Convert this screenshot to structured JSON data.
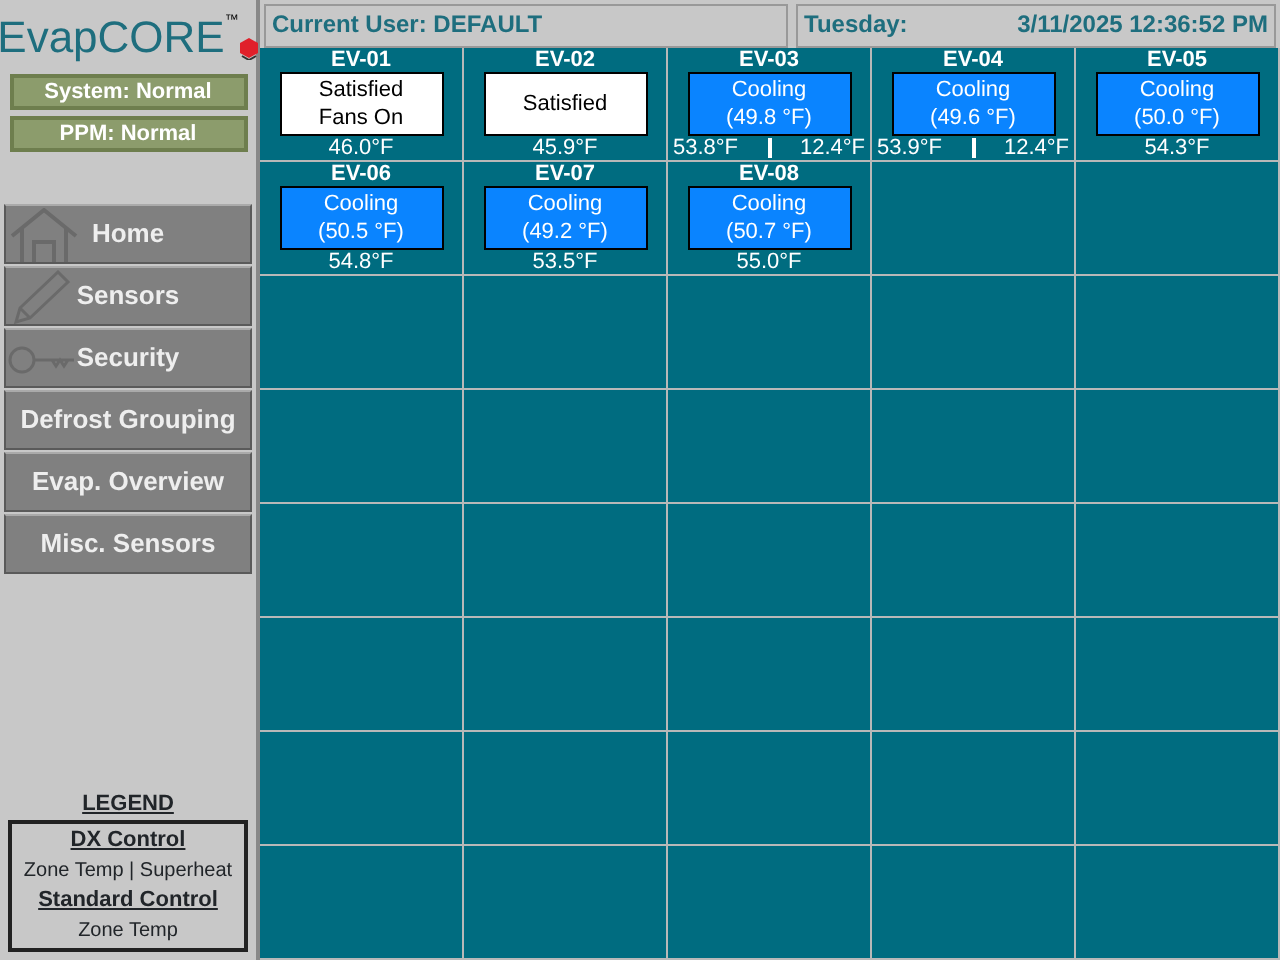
{
  "logo": {
    "text": "EvapCORE",
    "trademark": "™"
  },
  "status_indicators": [
    "System: Normal",
    "PPM: Normal"
  ],
  "nav": [
    {
      "label": "Home"
    },
    {
      "label": "Sensors"
    },
    {
      "label": "Security"
    },
    {
      "label": "Defrost Grouping"
    },
    {
      "label": "Evap. Overview"
    },
    {
      "label": "Misc. Sensors"
    }
  ],
  "legend": {
    "title": "LEGEND",
    "sections": [
      {
        "heading": "DX Control",
        "text": "Zone Temp | Superheat"
      },
      {
        "heading": "Standard Control",
        "text": "Zone Temp"
      }
    ]
  },
  "header": {
    "current_user": "Current User: DEFAULT",
    "day": "Tuesday:",
    "datetime": "3/11/2025 12:36:52 PM"
  },
  "units": [
    {
      "name": "EV-01",
      "kind": "satisfied",
      "status": [
        "Satisfied",
        "Fans On"
      ],
      "readings": [
        "46.0°F"
      ]
    },
    {
      "name": "EV-02",
      "kind": "satisfied",
      "status": [
        "Satisfied"
      ],
      "readings": [
        "45.9°F"
      ]
    },
    {
      "name": "EV-03",
      "kind": "cooling",
      "status": [
        "Cooling",
        "(49.8 °F)"
      ],
      "readings": [
        "53.8°F",
        "12.4°F"
      ]
    },
    {
      "name": "EV-04",
      "kind": "cooling",
      "status": [
        "Cooling",
        "(49.6 °F)"
      ],
      "readings": [
        "53.9°F",
        "12.4°F"
      ]
    },
    {
      "name": "EV-05",
      "kind": "cooling",
      "status": [
        "Cooling",
        "(50.0 °F)"
      ],
      "readings": [
        "54.3°F"
      ]
    },
    {
      "name": "EV-06",
      "kind": "cooling",
      "status": [
        "Cooling",
        "(50.5 °F)"
      ],
      "readings": [
        "54.8°F"
      ]
    },
    {
      "name": "EV-07",
      "kind": "cooling",
      "status": [
        "Cooling",
        "(49.2 °F)"
      ],
      "readings": [
        "53.5°F"
      ]
    },
    {
      "name": "EV-08",
      "kind": "cooling",
      "status": [
        "Cooling",
        "(50.7 °F)"
      ],
      "readings": [
        "55.0°F"
      ]
    }
  ]
}
